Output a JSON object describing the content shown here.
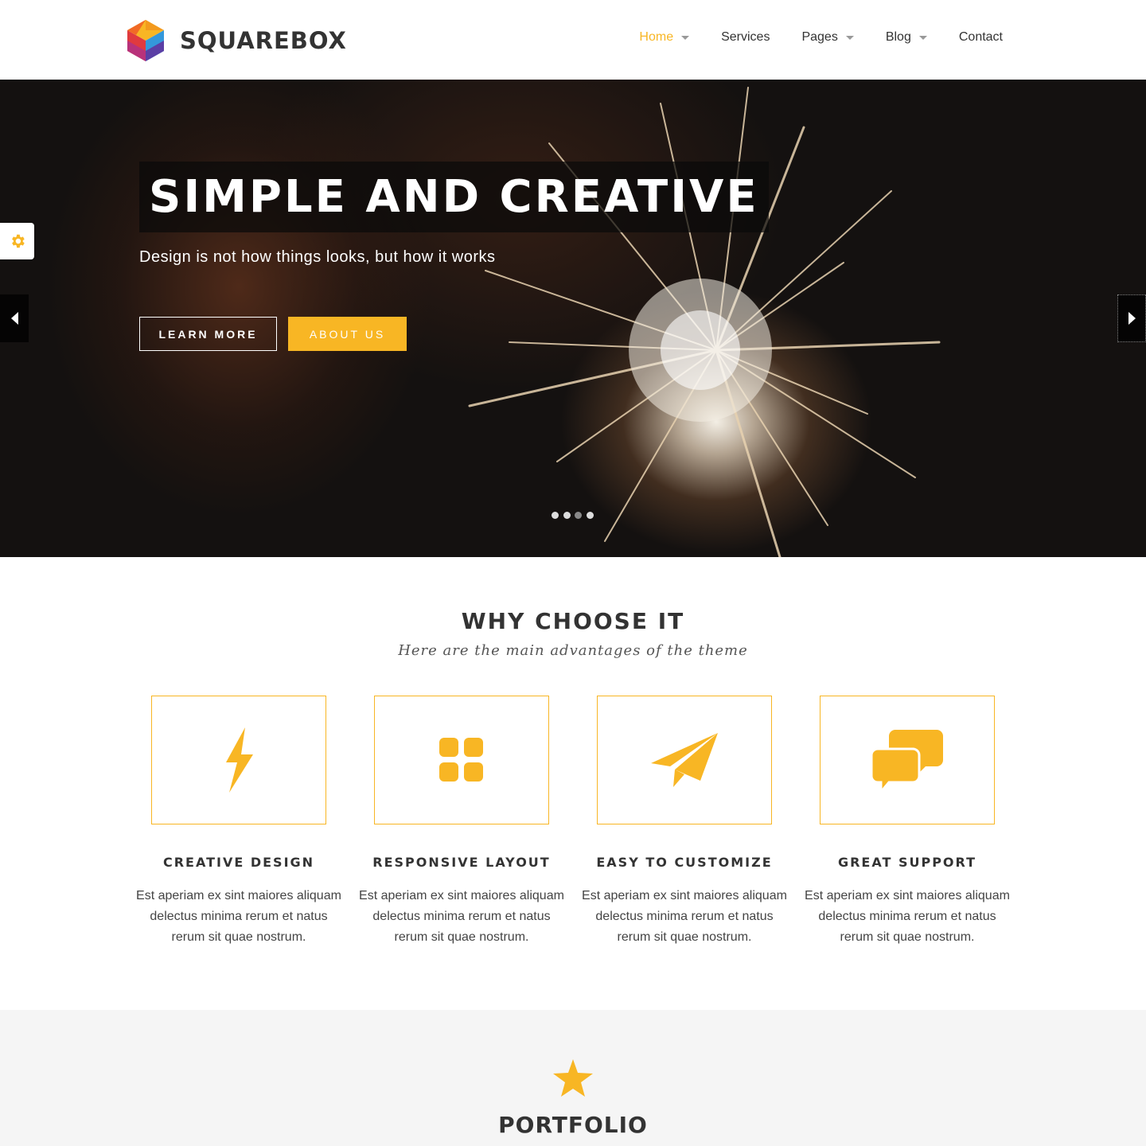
{
  "brand": {
    "name": "SQUAREBOX"
  },
  "nav": {
    "items": [
      {
        "label": "Home",
        "active": true,
        "dropdown": true
      },
      {
        "label": "Services",
        "active": false,
        "dropdown": false
      },
      {
        "label": "Pages",
        "active": false,
        "dropdown": true
      },
      {
        "label": "Blog",
        "active": false,
        "dropdown": true
      },
      {
        "label": "Contact",
        "active": false,
        "dropdown": false
      }
    ]
  },
  "hero": {
    "title": "SIMPLE AND CREATIVE",
    "subtitle": "Design is not how things looks, but how it works",
    "learn_more_label": "LEARN MORE",
    "about_us_label": "ABOUT US",
    "slides_count": 4,
    "active_slide": 3
  },
  "features": {
    "title": "WHY CHOOSE IT",
    "subtitle": "Here are the main advantages of the theme",
    "items": [
      {
        "icon": "lightning-icon",
        "heading": "CREATIVE DESIGN",
        "text": "Est aperiam ex sint maiores aliquam delectus minima rerum et natus rerum sit quae nostrum."
      },
      {
        "icon": "grid-icon",
        "heading": "RESPONSIVE LAYOUT",
        "text": "Est aperiam ex sint maiores aliquam delectus minima rerum et natus rerum sit quae nostrum."
      },
      {
        "icon": "paper-plane-icon",
        "heading": "EASY TO CUSTOMIZE",
        "text": "Est aperiam ex sint maiores aliquam delectus minima rerum et natus rerum sit quae nostrum."
      },
      {
        "icon": "chat-bubbles-icon",
        "heading": "GREAT SUPPORT",
        "text": "Est aperiam ex sint maiores aliquam delectus minima rerum et natus rerum sit quae nostrum."
      }
    ]
  },
  "portfolio": {
    "title": "PORTFOLIO",
    "icon": "star-icon"
  },
  "colors": {
    "accent": "#f8b624",
    "text": "#333333",
    "hero_bg": "#141110",
    "section_bg": "#f5f5f5"
  }
}
